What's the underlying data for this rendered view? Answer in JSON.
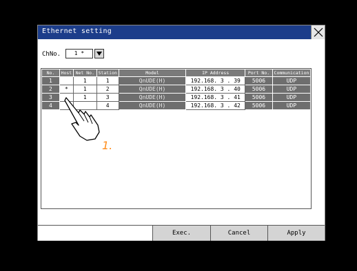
{
  "window": {
    "title": "Ethernet setting"
  },
  "channel": {
    "label": "ChNo.",
    "value": "1 *"
  },
  "table": {
    "headers": [
      "No.",
      "Host",
      "Net No.",
      "Station",
      "Model",
      "IP Address",
      "Port No.",
      "Communication"
    ],
    "rows": [
      {
        "no": "1",
        "host": "",
        "net": "1",
        "station": "1",
        "model": "QnUDE(H)",
        "ip": "192.168. 3 . 39",
        "port": "5006",
        "comm": "UDP"
      },
      {
        "no": "2",
        "host": "*",
        "net": "1",
        "station": "2",
        "model": "QnUDE(H)",
        "ip": "192.168. 3 . 40",
        "port": "5006",
        "comm": "UDP"
      },
      {
        "no": "3",
        "host": "",
        "net": "1",
        "station": "3",
        "model": "QnUDE(H)",
        "ip": "192.168. 3 . 41",
        "port": "5006",
        "comm": "UDP"
      },
      {
        "no": "4",
        "host": "",
        "net": "",
        "station": "4",
        "model": "QnUDE(H)",
        "ip": "192.168. 3 . 42",
        "port": "5006",
        "comm": "UDP"
      }
    ]
  },
  "buttons": {
    "exec": "Exec.",
    "cancel": "Cancel",
    "apply": "Apply"
  },
  "annotation": {
    "step": "1."
  },
  "colors": {
    "title_bar": "#1c3d8a",
    "header": "#7a7a7a",
    "row_dark": "#6e6e6e",
    "step_label": "#ff8c1a"
  },
  "icons": [
    "close-icon",
    "dropdown-arrow-icon",
    "pointing-hand-icon"
  ]
}
